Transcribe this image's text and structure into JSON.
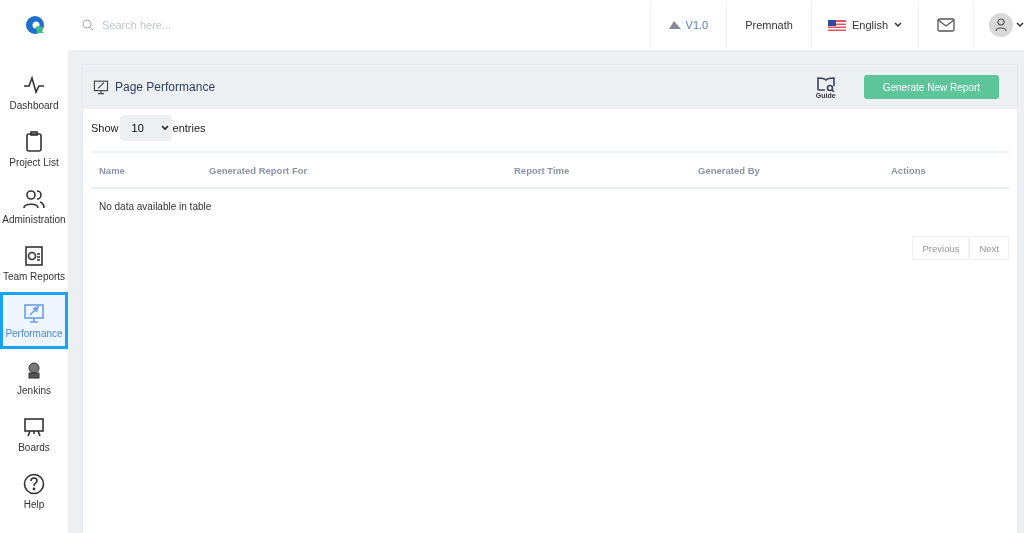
{
  "topbar": {
    "search": {
      "placeholder": "Search here..."
    },
    "version": "V1.0",
    "user": "Premnath",
    "language": "English"
  },
  "sidebar": {
    "items": [
      {
        "kind": "dashboard",
        "label": "Dashboard",
        "selected": false
      },
      {
        "kind": "projects",
        "label": "Project List",
        "selected": false
      },
      {
        "kind": "admin",
        "label": "Administration",
        "selected": false
      },
      {
        "kind": "reports",
        "label": "Team Reports",
        "selected": false
      },
      {
        "kind": "performance",
        "label": "Performance",
        "selected": true
      },
      {
        "kind": "jenkins",
        "label": "Jenkins",
        "selected": false
      },
      {
        "kind": "boards",
        "label": "Boards",
        "selected": false
      },
      {
        "kind": "help",
        "label": "Help",
        "selected": false
      }
    ]
  },
  "panel": {
    "title": "Page Performance",
    "guide": "Guide",
    "button": "Generate New Report",
    "length": {
      "before": "Show",
      "value": "10",
      "after": "entries"
    },
    "table": {
      "columns": [
        "Name",
        "Generated Report For",
        "Report Time",
        "Generated By",
        "Actions"
      ],
      "empty": "No data available in table"
    },
    "pagination": {
      "previous": "Previous",
      "next": "Next",
      "disabled": true
    }
  }
}
